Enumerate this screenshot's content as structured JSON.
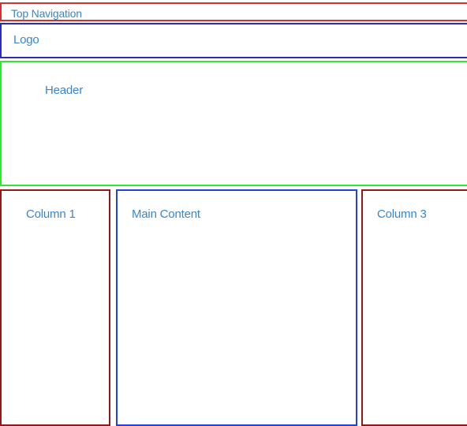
{
  "colors": {
    "label_text": "#3a86c8",
    "top_navigation_border": "#cc3333",
    "logo_border": "#2b2bb8",
    "header_border": "#33e633",
    "column_border": "#8e1a1a",
    "main_content_border": "#2144d6"
  },
  "regions": {
    "top_navigation": "Top Navigation",
    "logo": "Logo",
    "header": "Header",
    "column_1": "Column 1",
    "main_content": "Main Content",
    "column_3": "Column 3"
  }
}
